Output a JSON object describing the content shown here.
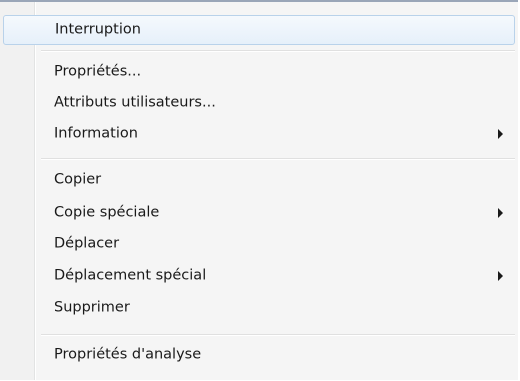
{
  "menu": {
    "items": [
      {
        "label": "Interruption"
      },
      {
        "label": "Propriétés..."
      },
      {
        "label": "Attributs utilisateurs..."
      },
      {
        "label": "Information"
      },
      {
        "label": "Copier"
      },
      {
        "label": "Copie spéciale"
      },
      {
        "label": "Déplacer"
      },
      {
        "label": "Déplacement spécial"
      },
      {
        "label": "Supprimer"
      },
      {
        "label": "Propriétés d'analyse"
      }
    ],
    "highlighted_item": "Interruption",
    "colors": {
      "highlight_border": "#b9d2ea",
      "highlight_fill": "#e6f0fa",
      "menu_background": "#f5f5f5"
    },
    "icons": {
      "submenu": "submenu-arrow-icon"
    }
  }
}
